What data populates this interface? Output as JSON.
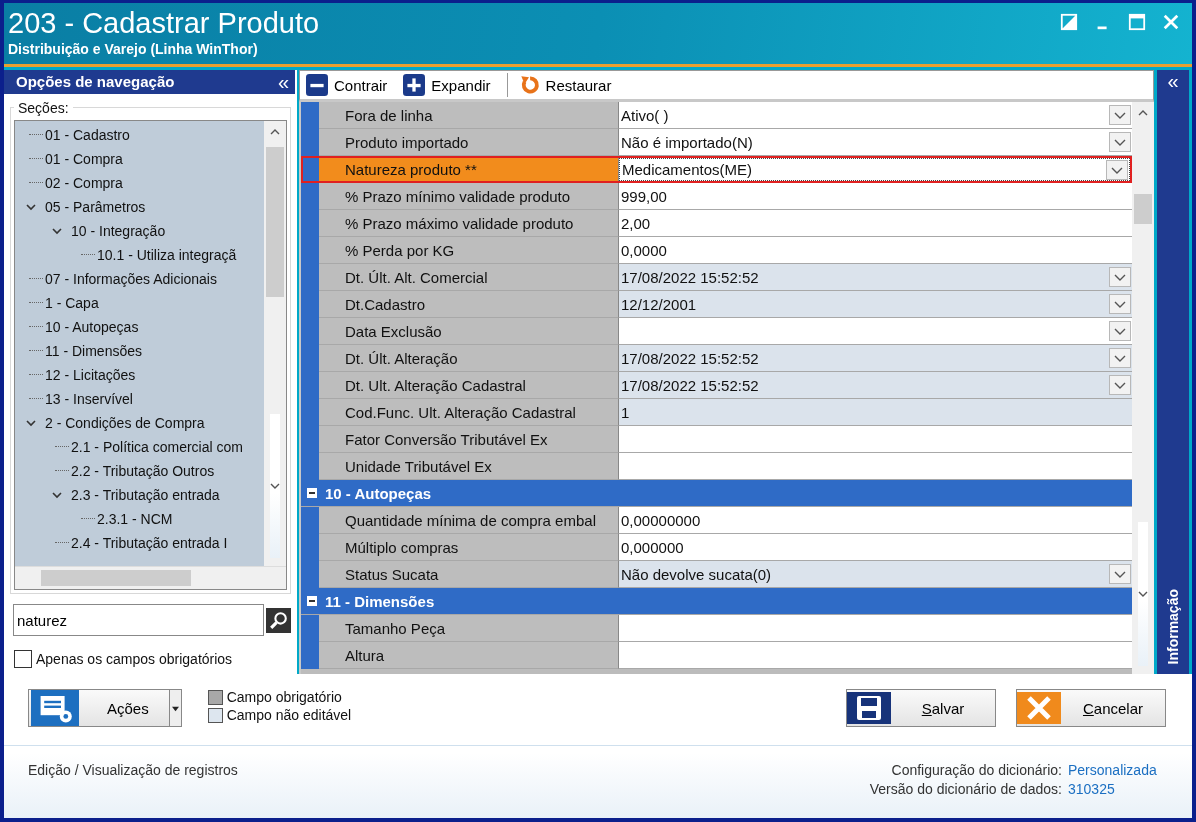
{
  "window": {
    "title": "203 - Cadastrar  Produto",
    "subtitle": "Distribuição e Varejo (Linha WinThor)"
  },
  "nav": {
    "title": "Opções de navegação",
    "collapse": "«",
    "group": "Seções:",
    "tree": [
      {
        "label": "01 - Cadastro"
      },
      {
        "label": "01 - Compra"
      },
      {
        "label": "02 - Compra"
      },
      {
        "label": "05 - Parâmetros",
        "expanded": true,
        "children": [
          {
            "label": "10 - Integração",
            "expanded": true,
            "children": [
              {
                "label": "10.1 - Utiliza integraçã"
              }
            ]
          }
        ]
      },
      {
        "label": "07 - Informações Adicionais"
      },
      {
        "label": "1 - Capa"
      },
      {
        "label": "10 - Autopeças"
      },
      {
        "label": "11 - Dimensões"
      },
      {
        "label": "12 - Licitações"
      },
      {
        "label": "13 - Inservível"
      },
      {
        "label": "2 - Condições de Compra",
        "expanded": true,
        "children": [
          {
            "label": "2.1 - Política comercial com"
          },
          {
            "label": "2.2 - Tributação Outros"
          },
          {
            "label": "2.3 - Tributação entrada",
            "expanded": true,
            "children": [
              {
                "label": "2.3.1 - NCM"
              }
            ]
          },
          {
            "label": "2.4 - Tributação entrada I"
          }
        ]
      }
    ],
    "search": {
      "value": "naturez"
    },
    "only_required": {
      "label": "Apenas os campos obrigatórios",
      "checked": false
    }
  },
  "toolbar": [
    {
      "kind": "collapse",
      "label": "Contrair"
    },
    {
      "kind": "expand",
      "label": "Expandir"
    },
    {
      "kind": "restore",
      "label": "Restaurar"
    }
  ],
  "grid": {
    "rows": [
      {
        "kind": "field",
        "label": "Fora de linha",
        "value": "Ativo( )",
        "editable": true,
        "dropdown": true,
        "selected": false
      },
      {
        "kind": "field",
        "label": "Produto importado",
        "value": "Não é importado(N)",
        "editable": true,
        "dropdown": true,
        "selected": false
      },
      {
        "kind": "field",
        "label": "Natureza produto **",
        "value": "Medicamentos(ME)",
        "editable": true,
        "dropdown": true,
        "selected": true
      },
      {
        "kind": "field",
        "label": "% Prazo mínimo validade produto",
        "value": "999,00",
        "editable": true,
        "dropdown": false,
        "selected": false
      },
      {
        "kind": "field",
        "label": "% Prazo máximo validade produto",
        "value": "2,00",
        "editable": true,
        "dropdown": false,
        "selected": false
      },
      {
        "kind": "field",
        "label": "% Perda por KG",
        "value": "0,0000",
        "editable": true,
        "dropdown": false,
        "selected": false
      },
      {
        "kind": "field",
        "label": "Dt. Últ. Alt. Comercial",
        "value": "17/08/2022 15:52:52",
        "editable": false,
        "dropdown": true,
        "selected": false
      },
      {
        "kind": "field",
        "label": "Dt.Cadastro",
        "value": "12/12/2001",
        "editable": false,
        "dropdown": true,
        "selected": false
      },
      {
        "kind": "field",
        "label": "Data Exclusão",
        "editable": true,
        "dropdown": true,
        "selected": false
      },
      {
        "kind": "field",
        "label": "Dt. Últ. Alteração",
        "value": "17/08/2022 15:52:52",
        "editable": false,
        "dropdown": true,
        "selected": false
      },
      {
        "kind": "field",
        "label": "Dt. Ult. Alteração Cadastral",
        "value": "17/08/2022 15:52:52",
        "editable": false,
        "dropdown": true,
        "selected": false
      },
      {
        "kind": "field",
        "label": "Cod.Func. Ult. Alteração Cadastral",
        "value": "1",
        "editable": false,
        "dropdown": false,
        "selected": false
      },
      {
        "kind": "field",
        "label": "Fator Conversão Tributável Ex",
        "editable": true,
        "dropdown": false,
        "selected": false
      },
      {
        "kind": "field",
        "label": "Unidade Tributável Ex",
        "editable": true,
        "dropdown": false,
        "selected": false
      },
      {
        "kind": "section",
        "label": "10 - Autopeças"
      },
      {
        "kind": "field",
        "label": "Quantidade mínima de compra embal",
        "value": "0,00000000",
        "editable": true,
        "dropdown": false,
        "selected": false
      },
      {
        "kind": "field",
        "label": "Múltiplo compras",
        "value": "0,000000",
        "editable": true,
        "dropdown": false,
        "selected": false
      },
      {
        "kind": "field",
        "label": "Status Sucata",
        "value": "Não devolve sucata(0)",
        "editable": false,
        "dropdown": true,
        "selected": false
      },
      {
        "kind": "section",
        "label": "11 - Dimensões"
      },
      {
        "kind": "field",
        "label": "Tamanho Peça",
        "editable": true,
        "dropdown": false,
        "selected": false
      },
      {
        "kind": "field",
        "label": "Altura",
        "editable": true,
        "dropdown": false,
        "selected": false
      }
    ]
  },
  "info_panel": {
    "collapse": "«",
    "label": "Informação"
  },
  "actions": {
    "label": "Ações"
  },
  "legend": [
    {
      "label": "Campo obrigatório",
      "color": "#a8a8a8"
    },
    {
      "label": "Campo não editável",
      "color": "#dde6ef"
    }
  ],
  "buttons": [
    {
      "kind": "save",
      "label": "Salvar"
    },
    {
      "kind": "cancel",
      "label": "Cancelar"
    }
  ],
  "footer": {
    "left": "Edição / Visualização de registros",
    "lines": [
      {
        "label": "Configuração do dicionário:",
        "value": "Personalizada"
      },
      {
        "label": "Versão do dicionário de dados:",
        "value": "310325"
      }
    ]
  }
}
